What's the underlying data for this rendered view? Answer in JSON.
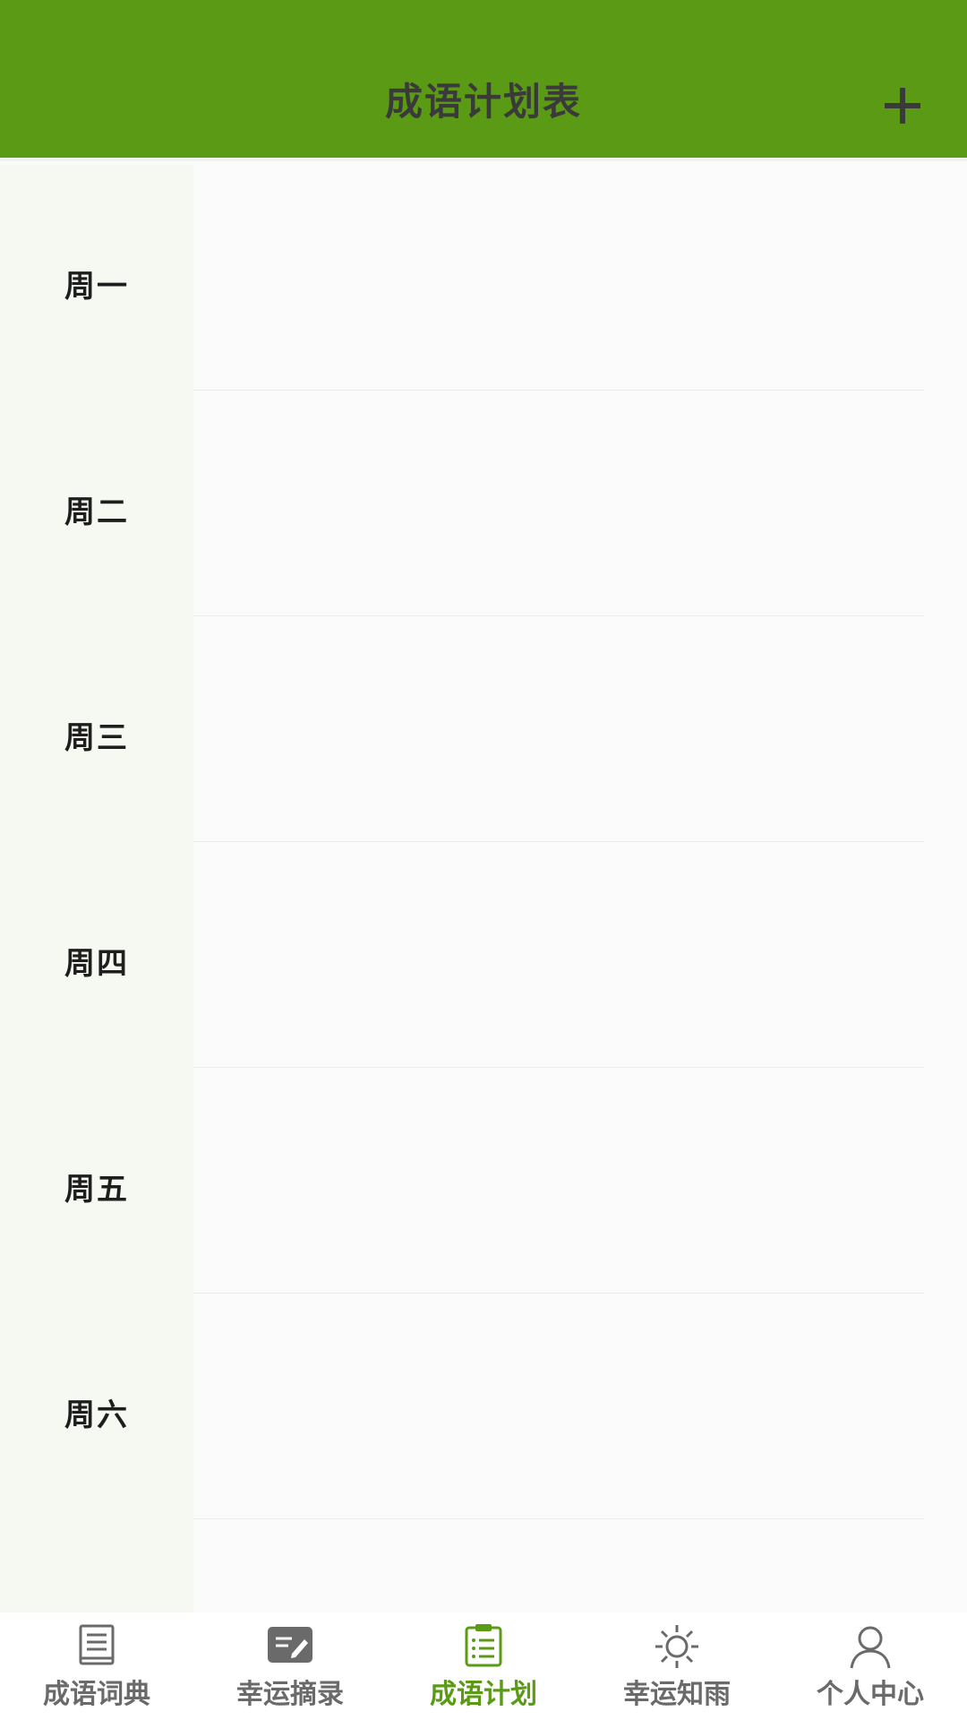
{
  "header": {
    "title": "成语计划表",
    "add_icon": "plus-icon"
  },
  "days": [
    "周一",
    "周二",
    "周三",
    "周四",
    "周五",
    "周六"
  ],
  "tabs": [
    {
      "label": "成语词典",
      "icon": "book-icon"
    },
    {
      "label": "幸运摘录",
      "icon": "edit-note-icon"
    },
    {
      "label": "成语计划",
      "icon": "clipboard-list-icon",
      "active": true
    },
    {
      "label": "幸运知雨",
      "icon": "sun-icon"
    },
    {
      "label": "个人中心",
      "icon": "user-icon"
    }
  ],
  "colors": {
    "brand_green": "#5a9a14",
    "header_text": "#3a3a3a",
    "tab_inactive": "#6a6a6a"
  }
}
